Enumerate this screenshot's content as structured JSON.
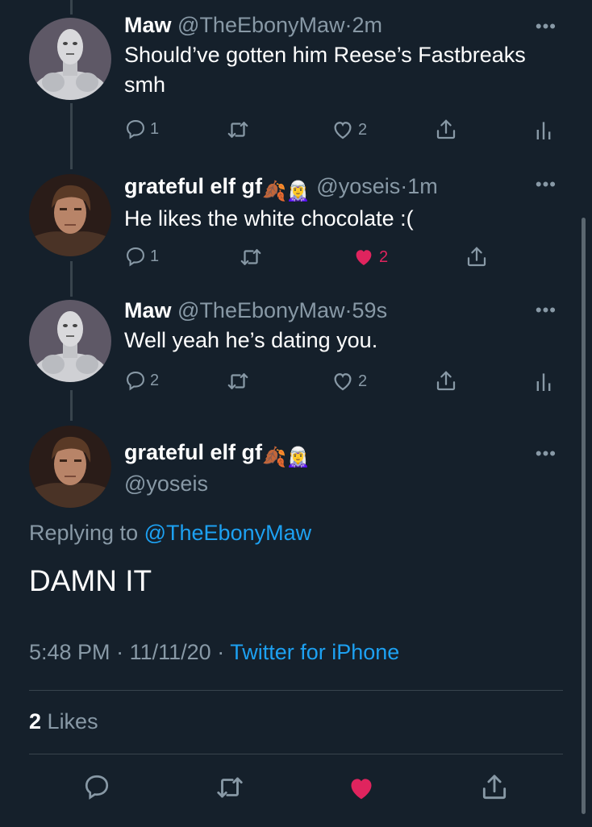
{
  "thread": [
    {
      "name": "Maw",
      "handle": "@TheEbonyMaw",
      "dot": "·",
      "time": "2m",
      "text": "Should’ve gotten him Reese’s Fastbreaks smh",
      "avatar": "white-armored-figure-avatar",
      "replies": "1",
      "likes": "2",
      "liked": false
    },
    {
      "name": "grateful elf gf",
      "emoji": "🍂🧝‍♀️",
      "handle": "@yoseis",
      "dot": "·",
      "time": "1m",
      "text": "He likes the white chocolate :(",
      "avatar": "dark-haired-man-avatar",
      "replies": "1",
      "likes": "2",
      "liked": true
    },
    {
      "name": "Maw",
      "handle": "@TheEbonyMaw",
      "dot": "·",
      "time": "59s",
      "text": "Well yeah he’s dating you.",
      "avatar": "white-armored-figure-avatar",
      "replies": "2",
      "likes": "2",
      "liked": false
    }
  ],
  "main_tweet": {
    "name": "grateful elf gf",
    "emoji": "🍂🧝‍♀️",
    "handle": "@yoseis",
    "replying_prefix": "Replying to",
    "replying_handle": "@TheEbonyMaw",
    "text": "DAMN IT",
    "time": "5:48 PM",
    "date": "11/11/20",
    "dot": "·",
    "source": "Twitter for iPhone",
    "likes_count": "2",
    "likes_label": "Likes",
    "liked": true
  },
  "colors": {
    "background": "#15202b",
    "secondary_text": "#8899a6",
    "link": "#1da1f2",
    "like": "#e0245e",
    "divider": "#38444d"
  }
}
